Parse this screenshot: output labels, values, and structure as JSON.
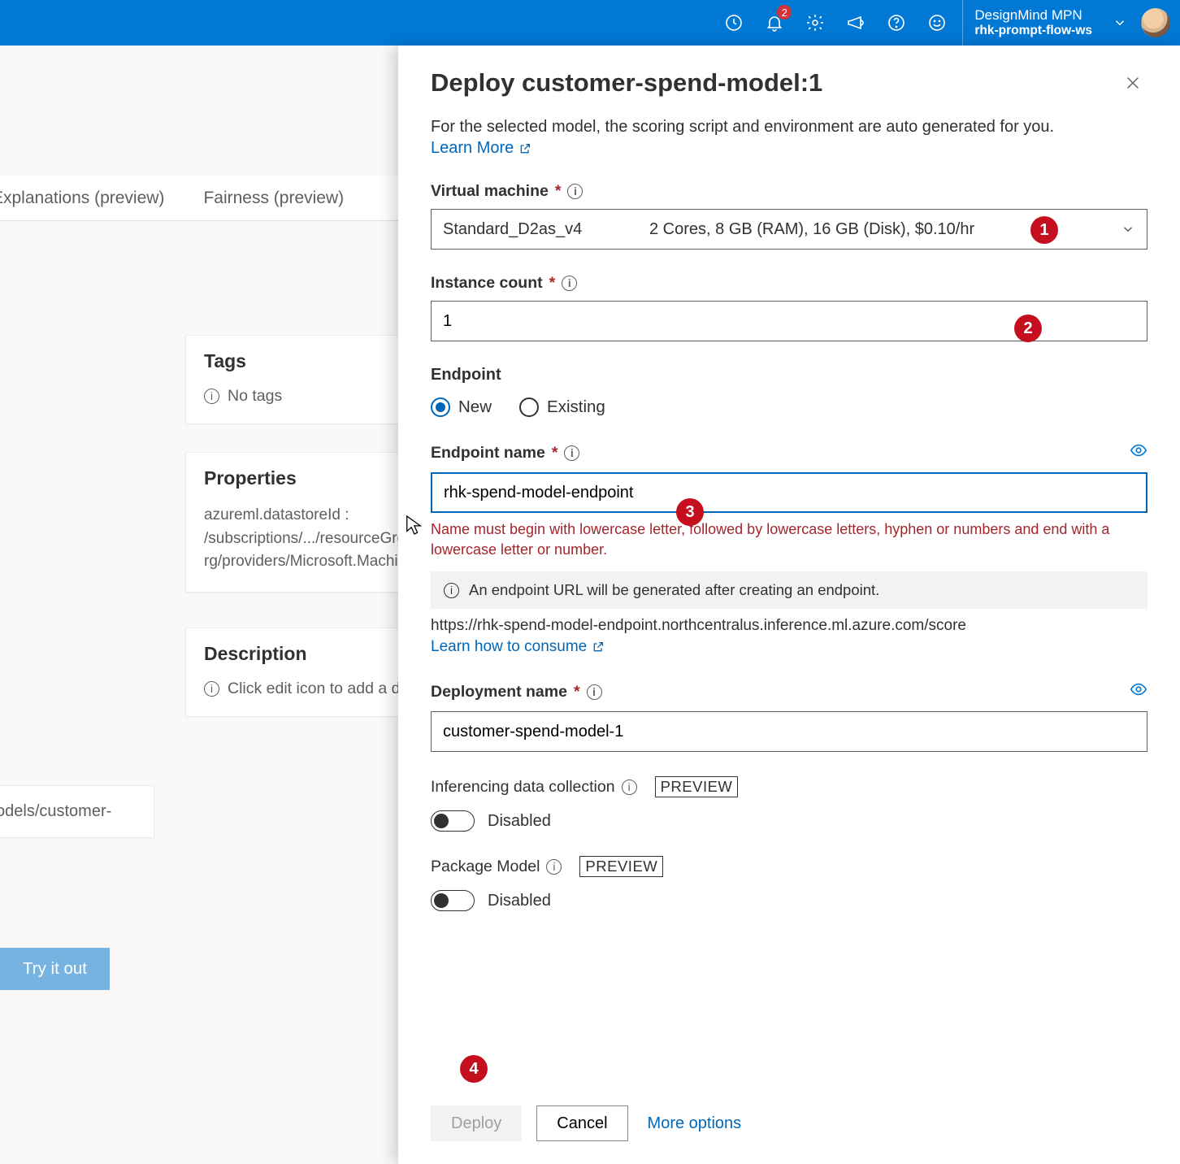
{
  "topbar": {
    "notification_badge": "2",
    "account_line1": "DesignMind MPN",
    "account_line2": "rhk-prompt-flow-ws"
  },
  "bg": {
    "tab_explanations": "Explanations (preview)",
    "tab_fairness": "Fairness (preview)",
    "tags_heading": "Tags",
    "tags_empty": "No tags",
    "props_heading": "Properties",
    "props_text": "azureml.datastoreId : /subscriptions/.../resourceGroups/rhk-rg/providers/Microsoft.MachineLearningServices/...",
    "desc_heading": "Description",
    "desc_empty": "Click edit icon to add a description",
    "models_snippet": "odels/customer-",
    "try_it": "Try it out"
  },
  "deploy": {
    "title": "Deploy customer-spend-model:1",
    "intro": "For the selected model, the scoring script and environment are auto generated for you.",
    "learn_more": "Learn More",
    "vm_label": "Virtual machine",
    "vm_value": "Standard_D2as_v4",
    "vm_details": "2 Cores, 8 GB (RAM), 16 GB (Disk), $0.10/hr",
    "instance_label": "Instance count",
    "instance_value": "1",
    "endpoint_heading": "Endpoint",
    "radio_new": "New",
    "radio_existing": "Existing",
    "endpoint_name_label": "Endpoint name",
    "endpoint_name_value": "rhk-spend-model-endpoint",
    "endpoint_name_validation": "Name must begin with lowercase letter, followed by lowercase letters, hyphen or numbers and end with a lowercase letter or number.",
    "endpoint_info_strip": "An endpoint URL will be generated after creating an endpoint.",
    "endpoint_url": "https://rhk-spend-model-endpoint.northcentralus.inference.ml.azure.com/score",
    "learn_consume": "Learn how to consume",
    "deployment_name_label": "Deployment name",
    "deployment_name_value": "customer-spend-model-1",
    "inference_label": "Inferencing data collection",
    "preview_tag": "PREVIEW",
    "disabled_label": "Disabled",
    "package_label": "Package Model",
    "deploy_btn": "Deploy",
    "cancel_btn": "Cancel",
    "more_options": "More options"
  },
  "callouts": {
    "c1": "1",
    "c2": "2",
    "c3": "3",
    "c4": "4"
  }
}
